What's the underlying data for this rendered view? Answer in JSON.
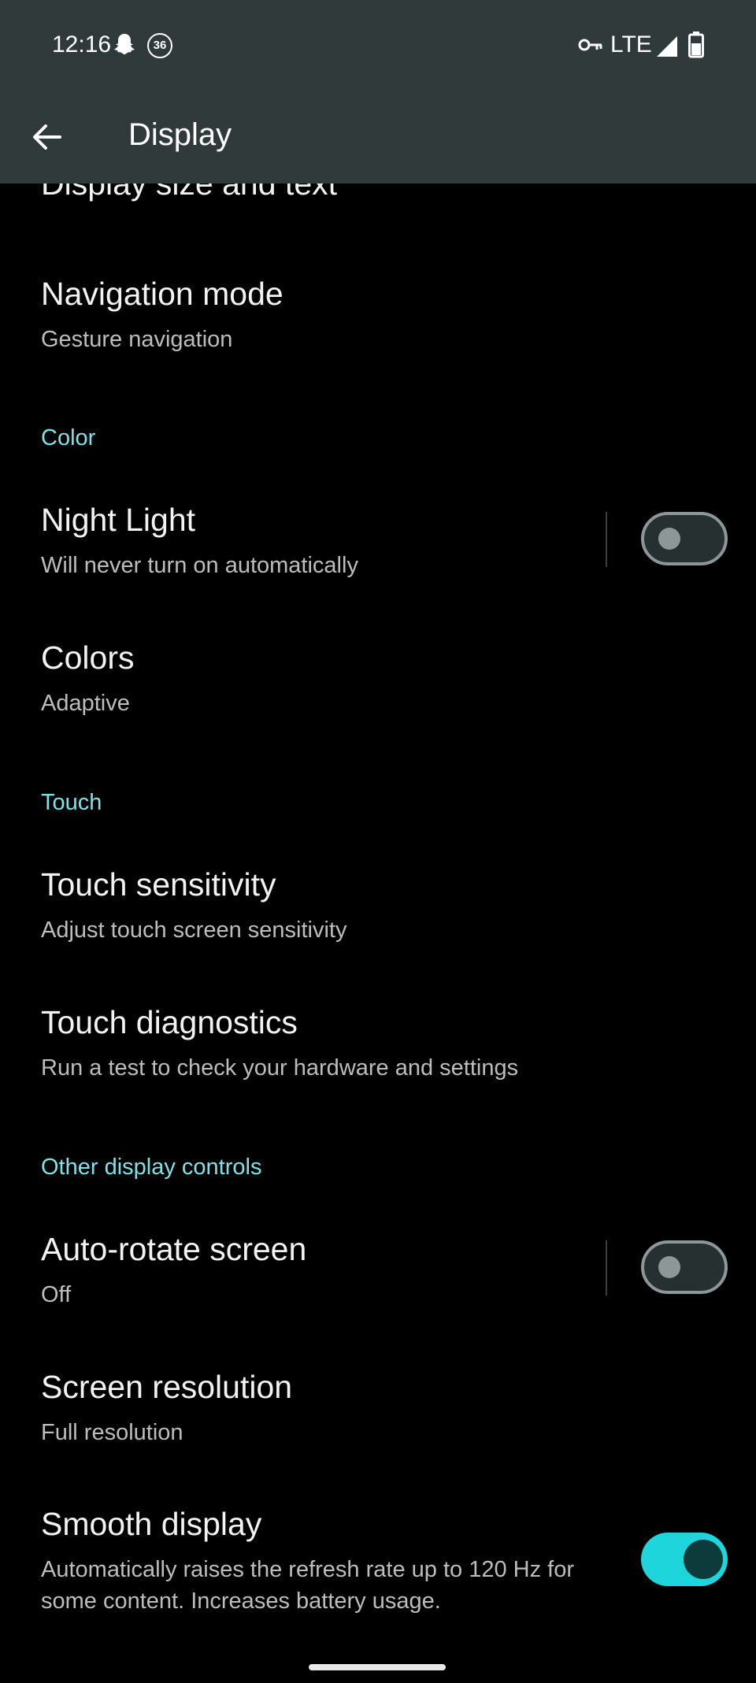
{
  "status_bar": {
    "time": "12:16",
    "notification_count": "36",
    "network": "LTE",
    "icons": [
      "snapchat-icon",
      "vpn-key-icon",
      "signal-icon",
      "battery-icon"
    ]
  },
  "app_bar": {
    "title": "Display",
    "back_icon": "arrow-back-icon"
  },
  "settings": {
    "display_size": {
      "title": "Display size and text"
    },
    "navigation_mode": {
      "title": "Navigation mode",
      "summary": "Gesture navigation"
    },
    "color_header": "Color",
    "night_light": {
      "title": "Night Light",
      "summary": "Will never turn on automatically",
      "enabled": false
    },
    "colors": {
      "title": "Colors",
      "summary": "Adaptive"
    },
    "touch_header": "Touch",
    "touch_sensitivity": {
      "title": "Touch sensitivity",
      "summary": "Adjust touch screen sensitivity"
    },
    "touch_diagnostics": {
      "title": "Touch diagnostics",
      "summary": "Run a test to check your hardware and settings"
    },
    "other_header": "Other display controls",
    "auto_rotate": {
      "title": "Auto-rotate screen",
      "summary": "Off",
      "enabled": false
    },
    "screen_resolution": {
      "title": "Screen resolution",
      "summary": "Full resolution"
    },
    "smooth_display": {
      "title": "Smooth display",
      "summary": "Automatically raises the refresh rate up to 120 Hz for some content. Increases battery usage.",
      "enabled": true
    }
  },
  "colors_theme": {
    "accent": "#7ee3e8",
    "toggle_on": "#1fd5dc",
    "app_bar": "#313a3a",
    "background": "#000000"
  }
}
